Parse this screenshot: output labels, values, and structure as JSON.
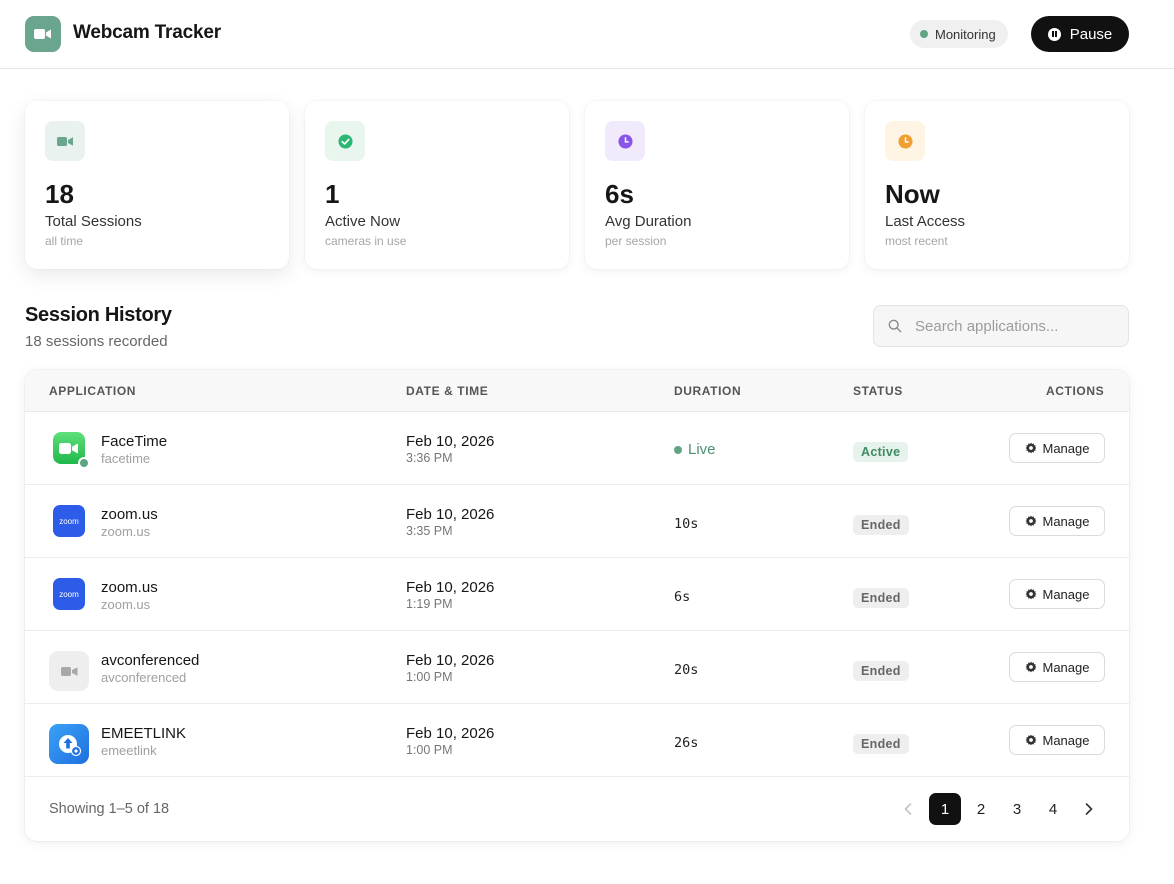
{
  "header": {
    "title": "Webcam Tracker",
    "status_label": "Monitoring",
    "pause_label": "Pause"
  },
  "stats": [
    {
      "value": "18",
      "label": "Total Sessions",
      "sub": "all time",
      "icon": "video-camera-icon",
      "color": "#6aa58d"
    },
    {
      "value": "1",
      "label": "Active Now",
      "sub": "cameras in use",
      "icon": "check-circle-icon",
      "color": "#2bb673"
    },
    {
      "value": "6s",
      "label": "Avg Duration",
      "sub": "per session",
      "icon": "clock-icon",
      "color": "#8a55e6"
    },
    {
      "value": "Now",
      "label": "Last Access",
      "sub": "most recent",
      "icon": "clock-icon",
      "color": "#f0a030"
    }
  ],
  "history": {
    "title": "Session History",
    "subtitle": "18 sessions recorded",
    "search_placeholder": "Search applications..."
  },
  "table": {
    "columns": [
      "APPLICATION",
      "DATE & TIME",
      "DURATION",
      "STATUS",
      "ACTIONS"
    ],
    "rows": [
      {
        "name": "FaceTime",
        "id": "facetime",
        "date": "Feb 10, 2026",
        "time": "3:36 PM",
        "duration": "Live",
        "status": "Active",
        "action": "Manage",
        "icon": "facetime-icon"
      },
      {
        "name": "zoom.us",
        "id": "zoom.us",
        "date": "Feb 10, 2026",
        "time": "3:35 PM",
        "duration": "10s",
        "status": "Ended",
        "action": "Manage",
        "icon": "zoom-icon"
      },
      {
        "name": "zoom.us",
        "id": "zoom.us",
        "date": "Feb 10, 2026",
        "time": "1:19 PM",
        "duration": "6s",
        "status": "Ended",
        "action": "Manage",
        "icon": "zoom-icon"
      },
      {
        "name": "avconferenced",
        "id": "avconferenced",
        "date": "Feb 10, 2026",
        "time": "1:00 PM",
        "duration": "20s",
        "status": "Ended",
        "action": "Manage",
        "icon": "generic-camera-icon"
      },
      {
        "name": "EMEETLINK",
        "id": "emeetlink",
        "date": "Feb 10, 2026",
        "time": "1:00 PM",
        "duration": "26s",
        "status": "Ended",
        "action": "Manage",
        "icon": "emeetlink-icon"
      }
    ],
    "zoom_logo_text": "zoom"
  },
  "pagination": {
    "showing": "Showing 1–5 of 18",
    "pages": [
      "1",
      "2",
      "3",
      "4"
    ],
    "current": "1"
  }
}
